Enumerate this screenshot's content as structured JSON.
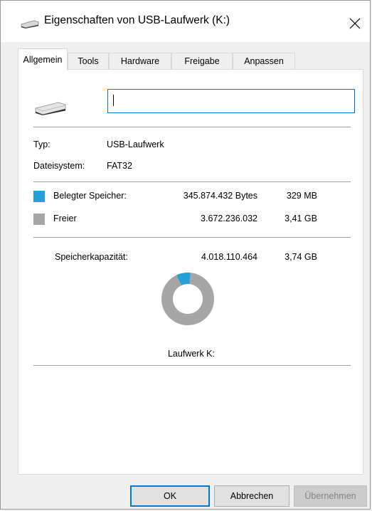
{
  "window": {
    "title": "Eigenschaften von USB-Laufwerk (K:)",
    "close_glyph": "✕"
  },
  "tabs": [
    {
      "label": "Allgemein",
      "active": true
    },
    {
      "label": "Tools",
      "active": false
    },
    {
      "label": "Hardware",
      "active": false
    },
    {
      "label": "Freigabe",
      "active": false
    },
    {
      "label": "Anpassen",
      "active": false
    }
  ],
  "general": {
    "name_value": "",
    "type_label": "Typ:",
    "type_value": "USB-Laufwerk",
    "fs_label": "Dateisystem:",
    "fs_value": "FAT32",
    "used": {
      "label": "Belegter Speicher:",
      "bytes": "345.874.432 Bytes",
      "size": "329 MB",
      "color": "#26a0da"
    },
    "free": {
      "label": "Freier",
      "bytes": "3.672.236.032",
      "size": "3,41 GB",
      "color": "#a6a6a6"
    },
    "capacity": {
      "label": "Speicherkapazität:",
      "bytes": "4.018.110.464",
      "size": "3,74 GB"
    },
    "used_fraction": 0.086,
    "drive_label": "Laufwerk K:"
  },
  "buttons": {
    "ok": "OK",
    "cancel": "Abbrechen",
    "apply": "Übernehmen"
  }
}
